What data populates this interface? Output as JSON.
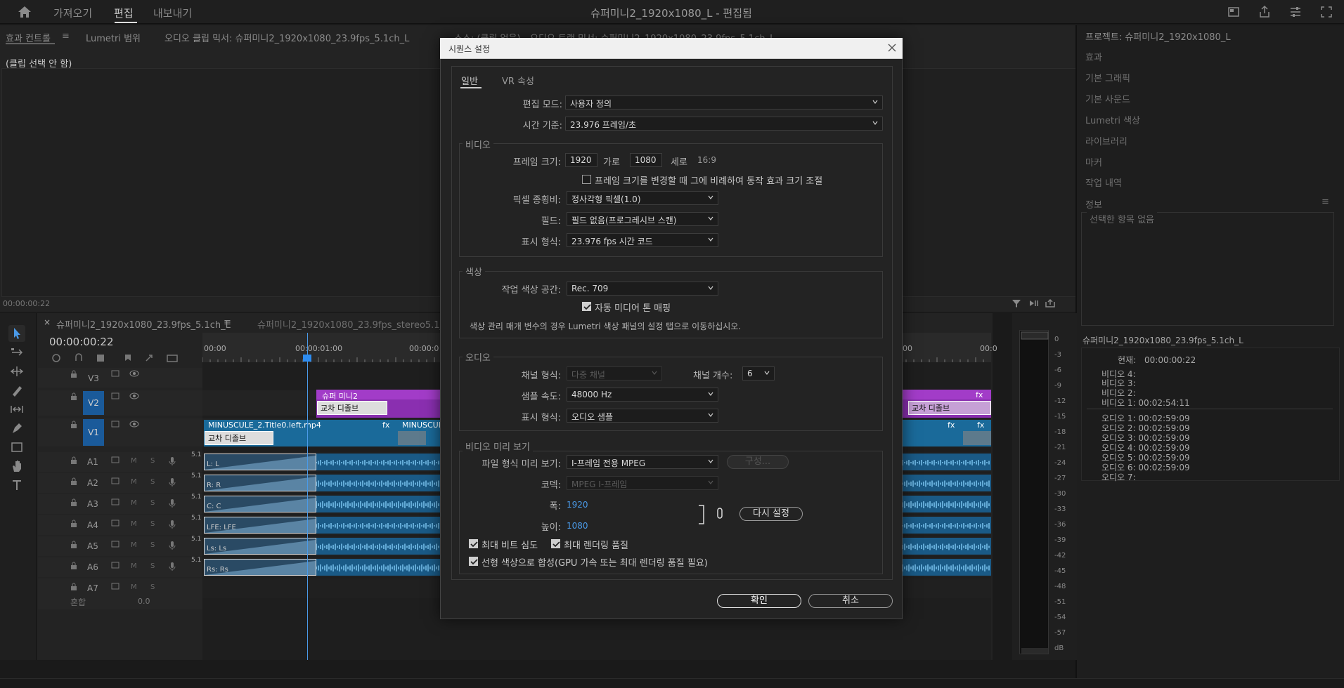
{
  "topbar": {
    "workspaces": [
      "가져오기",
      "편집",
      "내보내기"
    ],
    "title": "슈퍼미니2_1920x1080_L - 편집됨"
  },
  "fx_panel": {
    "tabs": [
      "효과 컨트롤",
      "Lumetri 범위",
      "오디오 클립 믹서: 슈퍼미니2_1920x1080_23.9fps_5.1ch_L",
      "소스: (클립 없음)",
      "오디오 트랙 믹서: 슈퍼미니2_1920x1080_23.9fps_5.1ch_L"
    ],
    "menu_glyph": "≡",
    "no_clip": "(클립 선택 안 함)",
    "timecode": "00:00:00:22"
  },
  "right_panels": {
    "items": [
      "프로젝트: 슈퍼미니2_1920x1080_L",
      "효과",
      "기본 그래픽",
      "기본 사운드",
      "Lumetri 색상",
      "라이브러리",
      "마커",
      "작업 내역",
      "정보"
    ],
    "info_empty": "선택한 항목 없음",
    "seq_name": "슈퍼미니2_1920x1080_23.9fps_5.1ch_L",
    "current_label": "현재:",
    "current_value": "00:00:00:22",
    "video_lines": [
      "비디오 4:",
      "비디오 3:",
      "비디오 2:",
      "비디오 1:  00:02:54:11"
    ],
    "audio_lines": [
      "오디오 1:  00:02:59:09",
      "오디오 2:  00:02:59:09",
      "오디오 3:  00:02:59:09",
      "오디오 4:  00:02:59:09",
      "오디오 5:  00:02:59:09",
      "오디오 6:  00:02:59:09",
      "오디오 7:"
    ]
  },
  "timeline": {
    "tab1": "슈퍼미니2_1920x1080_23.9fps_5.1ch_L",
    "tab2": "슈퍼미니2_1920x1080_23.9fps_stereo5.1_L",
    "close_glyph": "×",
    "menu_glyph": "≡",
    "timecode": "00:00:00:22",
    "ruler": [
      "00:00",
      "00:00:01:00",
      "00:00:0",
      "00",
      "00:0"
    ],
    "video_tracks": [
      "V3",
      "V2",
      "V1"
    ],
    "audio_tracks": [
      "A1",
      "A2",
      "A3",
      "A4",
      "A5",
      "A6",
      "A7"
    ],
    "track_letter_m": "M",
    "track_letter_s": "S",
    "audio_badge": "5.1",
    "mix_label": "혼합",
    "mix_value": "0.0",
    "v2_clip": "슈퍼 미니2",
    "transition": "교차 디졸브",
    "v1_clip": "MINUSCULE_2.Title0.left.mp4",
    "v1_clip2": "MINUSCULE",
    "fx_glyph": "fx",
    "channels": [
      "L: L",
      "R: R",
      "C: C",
      "LFE: LFE",
      "Ls: Ls",
      "Rs: Rs"
    ]
  },
  "meter": {
    "scale": [
      "0",
      "-3",
      "-6",
      "-9",
      "-12",
      "-15",
      "-18",
      "-21",
      "-24",
      "-27",
      "-30",
      "-33",
      "-36",
      "-39",
      "-42",
      "-45",
      "-48",
      "-51",
      "-54",
      "-57",
      "dB"
    ]
  },
  "dialog": {
    "title": "시퀀스 설정",
    "tabs": [
      "일반",
      "VR 속성"
    ],
    "edit_mode_label": "편집 모드:",
    "edit_mode_value": "사용자 정의",
    "timebase_label": "시간 기준:",
    "timebase_value": "23.976  프레임/초",
    "video_section": "비디오",
    "frame_size_label": "프레임 크기:",
    "frame_w": "1920",
    "horiz_label": "가로",
    "frame_h": "1080",
    "vert_label": "세로",
    "aspect": "16:9",
    "scale_cb": "프레임 크기를 변경할 때 그에 비례하여 동작 효과 크기 조절",
    "pixel_aspect_label": "픽셀 종횡비:",
    "pixel_aspect_value": "정사각형 픽셀(1.0)",
    "fields_label": "필드:",
    "fields_value": "필드 없음(프로그레시브 스캔)",
    "display_format_label": "표시 형식:",
    "display_format_value": "23.976 fps 시간 코드",
    "color_section": "색상",
    "working_cs_label": "작업 색상 공간:",
    "working_cs_value": "Rec. 709",
    "auto_tone_cb": "자동 미디어 톤 매핑",
    "color_note": "색상 관리 매개 변수의 경우 Lumetri 색상 패널의 설정 탭으로 이동하십시오.",
    "audio_section": "오디오",
    "channel_format_label": "채널 형식:",
    "channel_format_value": "다중 채널",
    "channel_count_label": "채널 개수:",
    "channel_count_value": "6",
    "sample_rate_label": "샘플 속도:",
    "sample_rate_value": "48000 Hz",
    "audio_display_label": "표시 형식:",
    "audio_display_value": "오디오 샘플",
    "preview_section": "비디오 미리 보기",
    "preview_format_label": "파일 형식 미리 보기:",
    "preview_format_value": "I-프레임 전용 MPEG",
    "configure": "구성...",
    "codec_label": "코덱:",
    "codec_value": "MPEG I-프레임",
    "width_label": "폭:",
    "width_value": "1920",
    "height_label": "높이:",
    "height_value": "1080",
    "reset": "다시 설정",
    "max_bit_cb": "최대 비트 심도",
    "max_render_cb": "최대 렌더링 품질",
    "linear_cb": "선형 색상으로 합성(GPU 가속 또는 최대 렌더링 품질 필요)",
    "ok": "확인",
    "cancel": "취소"
  }
}
